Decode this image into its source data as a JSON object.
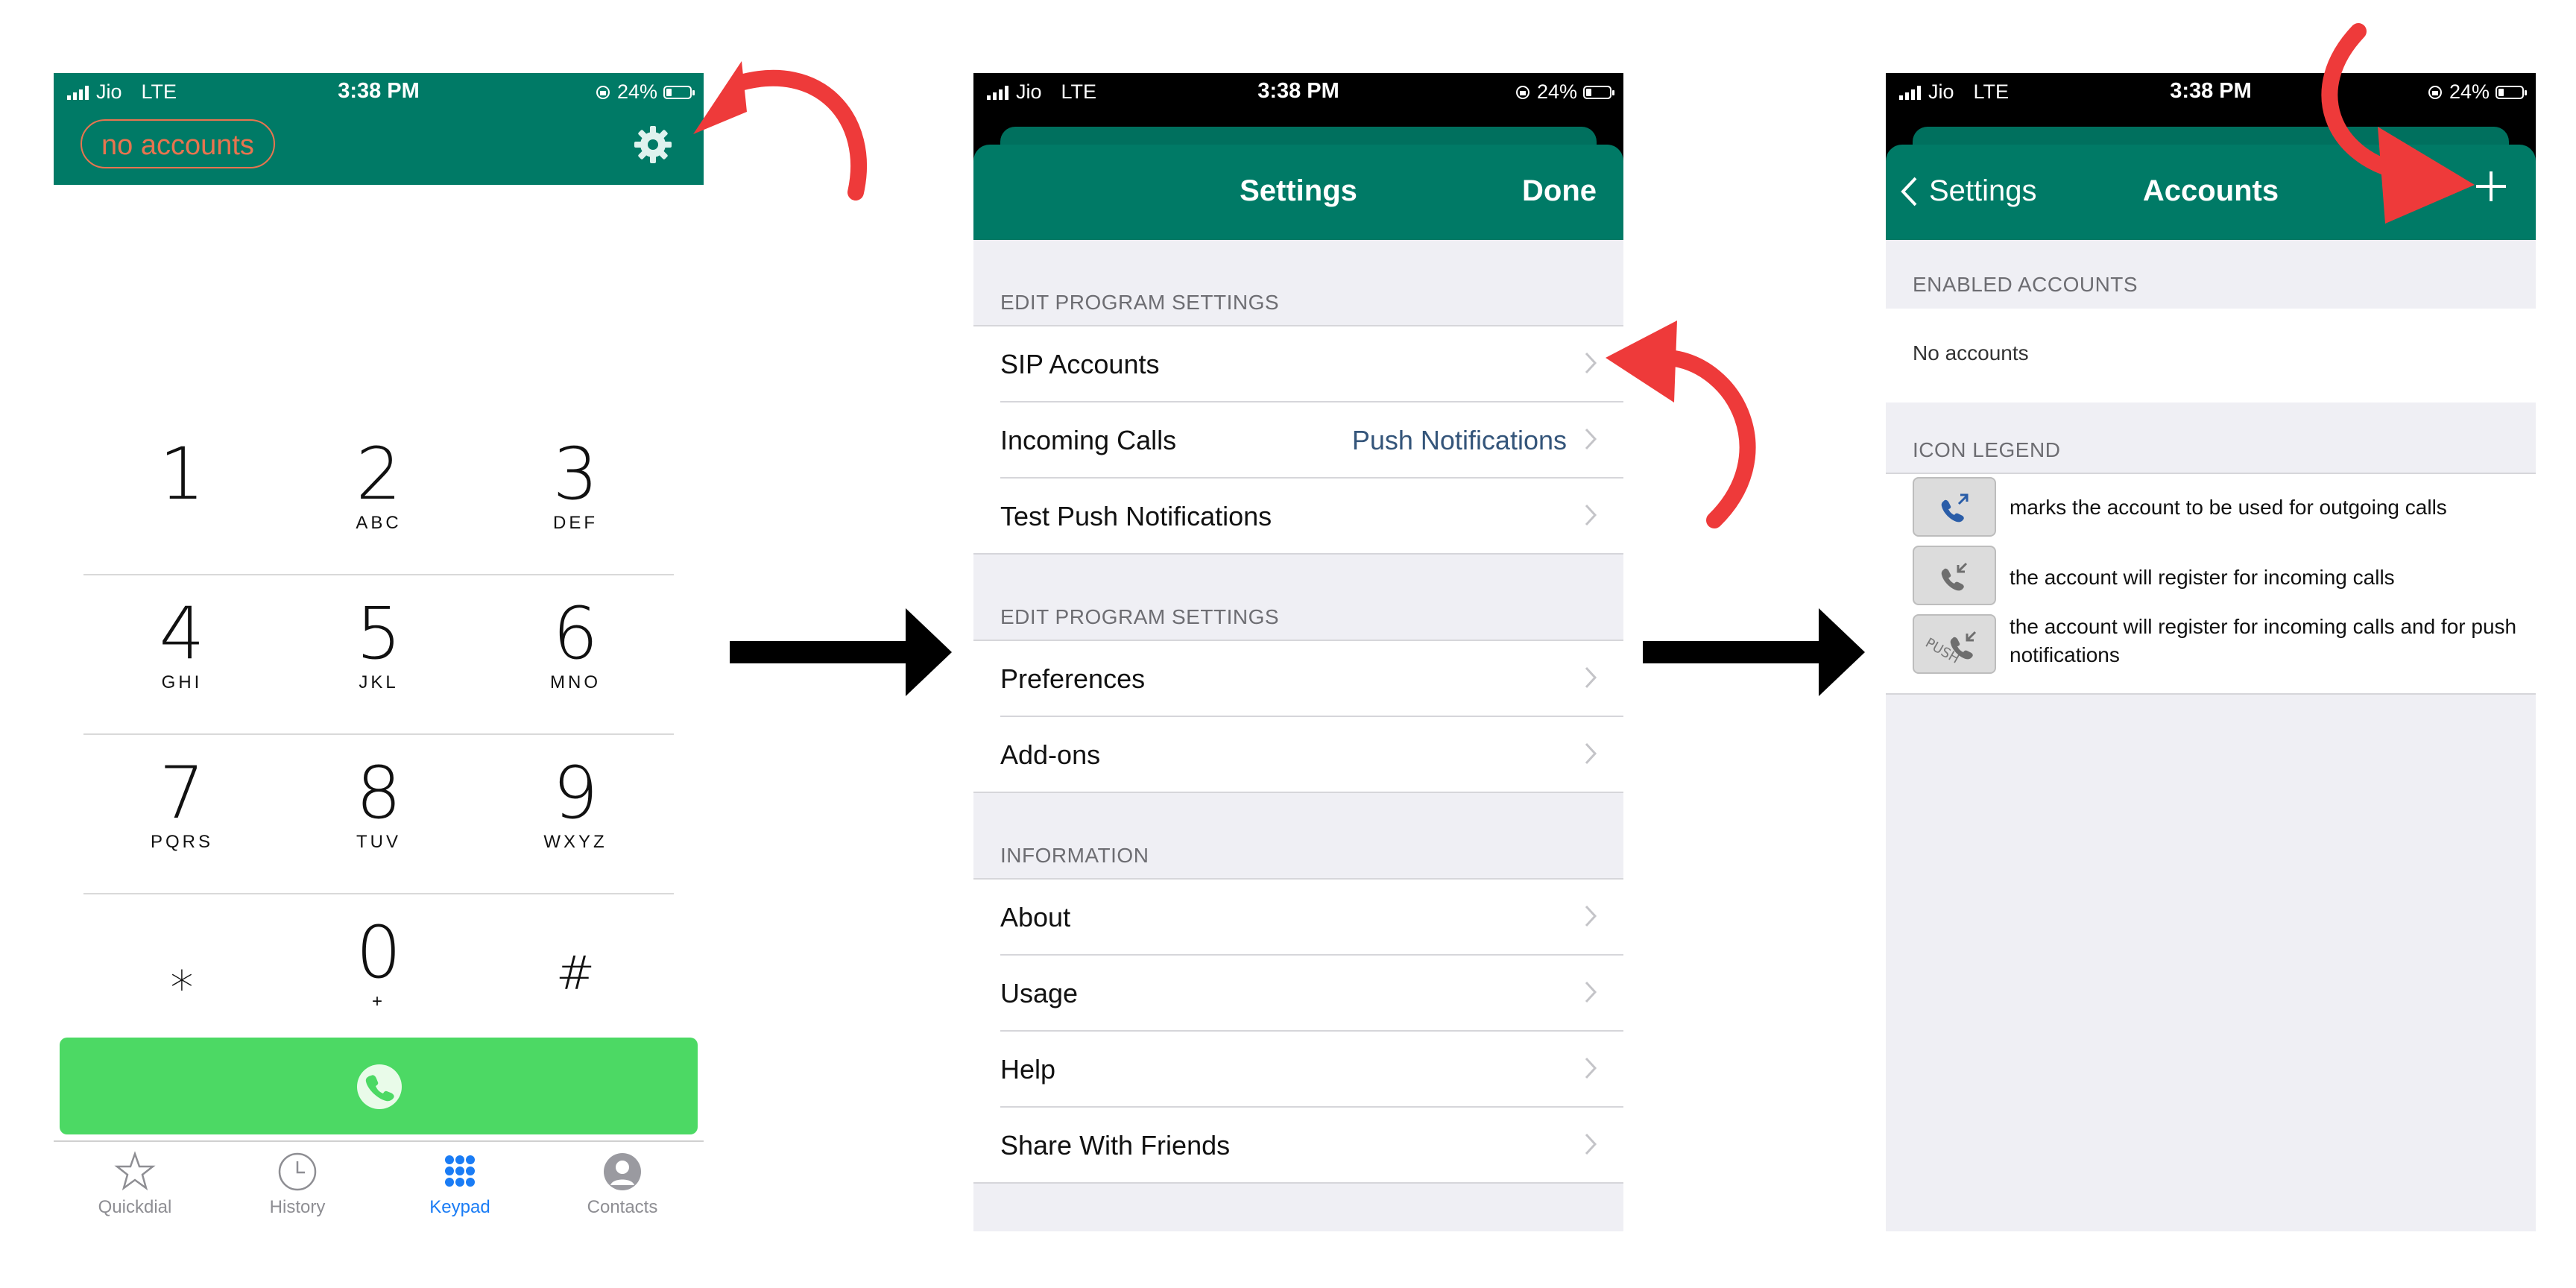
{
  "status_bar": {
    "carrier": "Jio",
    "network": "LTE",
    "time": "3:38 PM",
    "battery": "24%"
  },
  "dialer": {
    "account_badge": "no accounts",
    "keys": [
      [
        {
          "digit": "1",
          "letters": ""
        },
        {
          "digit": "2",
          "letters": "ABC"
        },
        {
          "digit": "3",
          "letters": "DEF"
        }
      ],
      [
        {
          "digit": "4",
          "letters": "GHI"
        },
        {
          "digit": "5",
          "letters": "JKL"
        },
        {
          "digit": "6",
          "letters": "MNO"
        }
      ],
      [
        {
          "digit": "7",
          "letters": "PQRS"
        },
        {
          "digit": "8",
          "letters": "TUV"
        },
        {
          "digit": "9",
          "letters": "WXYZ"
        }
      ],
      [
        {
          "digit": "⁎",
          "letters": ""
        },
        {
          "digit": "0",
          "letters": "+"
        },
        {
          "digit": "#",
          "letters": ""
        }
      ]
    ],
    "tabs": [
      {
        "label": "Quickdial",
        "icon": "star-icon"
      },
      {
        "label": "History",
        "icon": "clock-icon"
      },
      {
        "label": "Keypad",
        "icon": "keypad-icon",
        "active": true
      },
      {
        "label": "Contacts",
        "icon": "contact-icon"
      }
    ],
    "call_color": "#4cd964"
  },
  "settings": {
    "title": "Settings",
    "done_label": "Done",
    "sections": [
      {
        "header": "EDIT PROGRAM SETTINGS",
        "rows": [
          {
            "label": "SIP Accounts",
            "value": ""
          },
          {
            "label": "Incoming Calls",
            "value": "Push Notifications"
          },
          {
            "label": "Test Push Notifications",
            "value": ""
          }
        ]
      },
      {
        "header": "EDIT PROGRAM SETTINGS",
        "rows": [
          {
            "label": "Preferences",
            "value": ""
          },
          {
            "label": "Add-ons",
            "value": ""
          }
        ]
      },
      {
        "header": "INFORMATION",
        "rows": [
          {
            "label": "About",
            "value": ""
          },
          {
            "label": "Usage",
            "value": ""
          },
          {
            "label": "Help",
            "value": ""
          },
          {
            "label": "Share With Friends",
            "value": ""
          }
        ]
      }
    ]
  },
  "accounts": {
    "back_label": "Settings",
    "title": "Accounts",
    "enabled_header": "ENABLED ACCOUNTS",
    "empty_text": "No accounts",
    "legend_header": "ICON LEGEND",
    "legend": [
      {
        "icon": "outgoing-call-icon",
        "text": "marks the account to be used for outgoing calls"
      },
      {
        "icon": "incoming-call-icon",
        "text": "the account will register for incoming calls"
      },
      {
        "icon": "push-incoming-call-icon",
        "text": "the account will register for incoming calls and for push notifications"
      }
    ]
  },
  "colors": {
    "brand": "#007a66",
    "accent_red": "#ee3a3a",
    "link_blue": "#1a7cf5",
    "badge_orange": "#e8744f"
  }
}
